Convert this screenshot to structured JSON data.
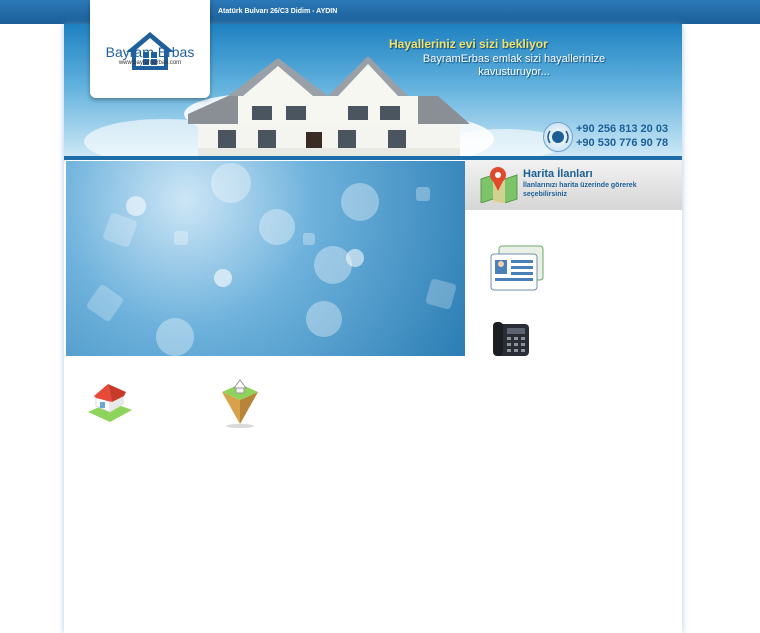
{
  "topbar": {
    "address": "Atatürk Bulvarı 26/C3 Didim - AYDIN"
  },
  "logo": {
    "name": "Bayram Erbas",
    "url": "www.bayramerbas.com"
  },
  "header": {
    "slogan_title": "Hayalleriniz evi sizi bekliyor",
    "slogan_line1": "BayramErbas emlak sizi hayallerinize",
    "slogan_line2": "kavusturuyor...",
    "phone1": "+90 256 813 20 03",
    "phone2": "+90 530 776 90 78"
  },
  "map_listings": {
    "title": "Harita İlanları",
    "subtitle": "İlanlarınızı harita üzerinde görerek seçebilirsiniz"
  },
  "colors": {
    "top_bar": "#1f6aa6",
    "accent": "#1c5f98",
    "slogan_yellow": "#f3e26a"
  },
  "icons": [
    "map-pin-icon",
    "listings-card-icon",
    "desk-phone-icon",
    "house-icon",
    "land-icon",
    "phone-ring-icon",
    "logo-house-icon"
  ]
}
